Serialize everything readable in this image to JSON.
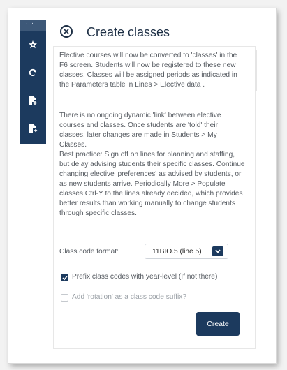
{
  "dialog": {
    "title": "Create classes",
    "paragraphs": [
      "Elective courses will now be converted to 'classes' in the F6 screen. Students will now be registered to these new classes. Classes will be assigned periods as indicated in the Parameters table in Lines > Elective data .",
      "There is no ongoing dynamic 'link' between elective courses and classes. Once students are 'told' their classes, later changes are made in Students > My Classes.",
      "Best practice: Sign off on lines for planning and staffing, but delay advising students their specific classes. Continue changing elective 'preferences' as advised by students, or as new students arrive. Periodically More > Populate classes Ctrl-Y to the lines already decided, which provides better results than working manually to change students through specific classes."
    ],
    "class_code_label": "Class code format:",
    "class_code_value": "11BIO.5  (line 5)",
    "prefix_checkbox_label": "Prefix class codes with year-level (If not there)",
    "prefix_checked": true,
    "rotation_checkbox_label": "Add 'rotation' as a class code suffix?",
    "rotation_checked": false,
    "create_label": "Create"
  },
  "rail": {
    "handle": "· · ·",
    "icons": [
      "star-icon",
      "refresh-icon",
      "add-document-icon",
      "export-document-icon"
    ]
  },
  "colors": {
    "navy": "#1c3a5e",
    "text": "#555a60"
  }
}
